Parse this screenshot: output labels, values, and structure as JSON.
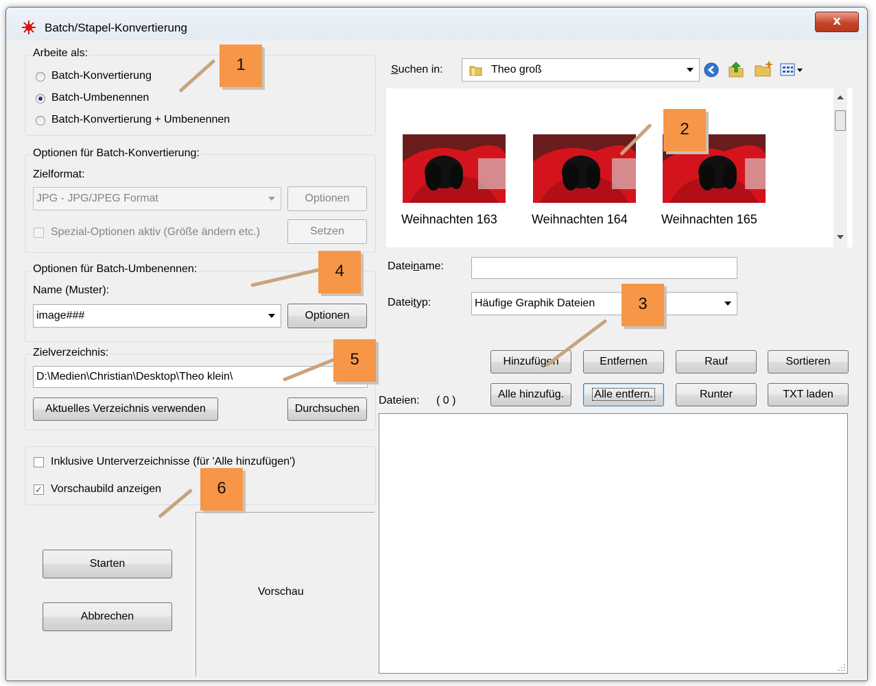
{
  "window": {
    "title": "Batch/Stapel-Konvertierung",
    "close_label": "x"
  },
  "mode_group": {
    "legend": "Arbeite als:",
    "options": [
      "Batch-Konvertierung",
      "Batch-Umbenennen",
      "Batch-Konvertierung + Umbenennen"
    ],
    "selected": "Batch-Umbenennen"
  },
  "convert_group": {
    "legend": "Optionen für Batch-Konvertierung:",
    "format_label": "Zielformat:",
    "format_value": "JPG - JPG/JPEG Format",
    "options_button": "Optionen",
    "special_label": "Spezial-Optionen aktiv (Größe ändern etc.)",
    "set_button": "Setzen"
  },
  "rename_group": {
    "legend": "Optionen für Batch-Umbenennen:",
    "pattern_label": "Name (Muster):",
    "pattern_value": "image###",
    "options_button": "Optionen"
  },
  "target_group": {
    "legend": "Zielverzeichnis:",
    "path_value": "D:\\Medien\\Christian\\Desktop\\Theo klein\\",
    "use_current_button": "Aktuelles Verzeichnis verwenden",
    "browse_button": "Durchsuchen"
  },
  "flags": {
    "include_subdirs": "Inklusive Unterverzeichnisse (für 'Alle hinzufügen')",
    "show_preview": "Vorschaubild anzeigen",
    "include_subdirs_checked": false,
    "show_preview_checked": true
  },
  "actions": {
    "start": "Starten",
    "cancel": "Abbrechen"
  },
  "preview_label": "Vorschau",
  "browser": {
    "search_in_label": "Suchen in:",
    "search_in_value": "Theo groß",
    "files": [
      "Weihnachten 163",
      "Weihnachten 164",
      "Weihnachten 165"
    ],
    "filename_label": "Dateiname:",
    "filename_value": "",
    "filetype_label": "Dateityp:",
    "filetype_value": "Häufige Graphik Dateien"
  },
  "list_buttons": {
    "add": "Hinzufügen",
    "remove": "Entfernen",
    "up": "Rauf",
    "sort": "Sortieren",
    "add_all": "Alle hinzufüg.",
    "remove_all": "Alle entfern.",
    "down": "Runter",
    "load_txt": "TXT laden"
  },
  "files_label": "Dateien:",
  "files_count": "( 0 )",
  "badges": [
    "1",
    "2",
    "3",
    "4",
    "5",
    "6"
  ],
  "colors": {
    "badge": "#f79646",
    "pointer": "#c7a37f",
    "dog_blanket": "#d4141c"
  }
}
